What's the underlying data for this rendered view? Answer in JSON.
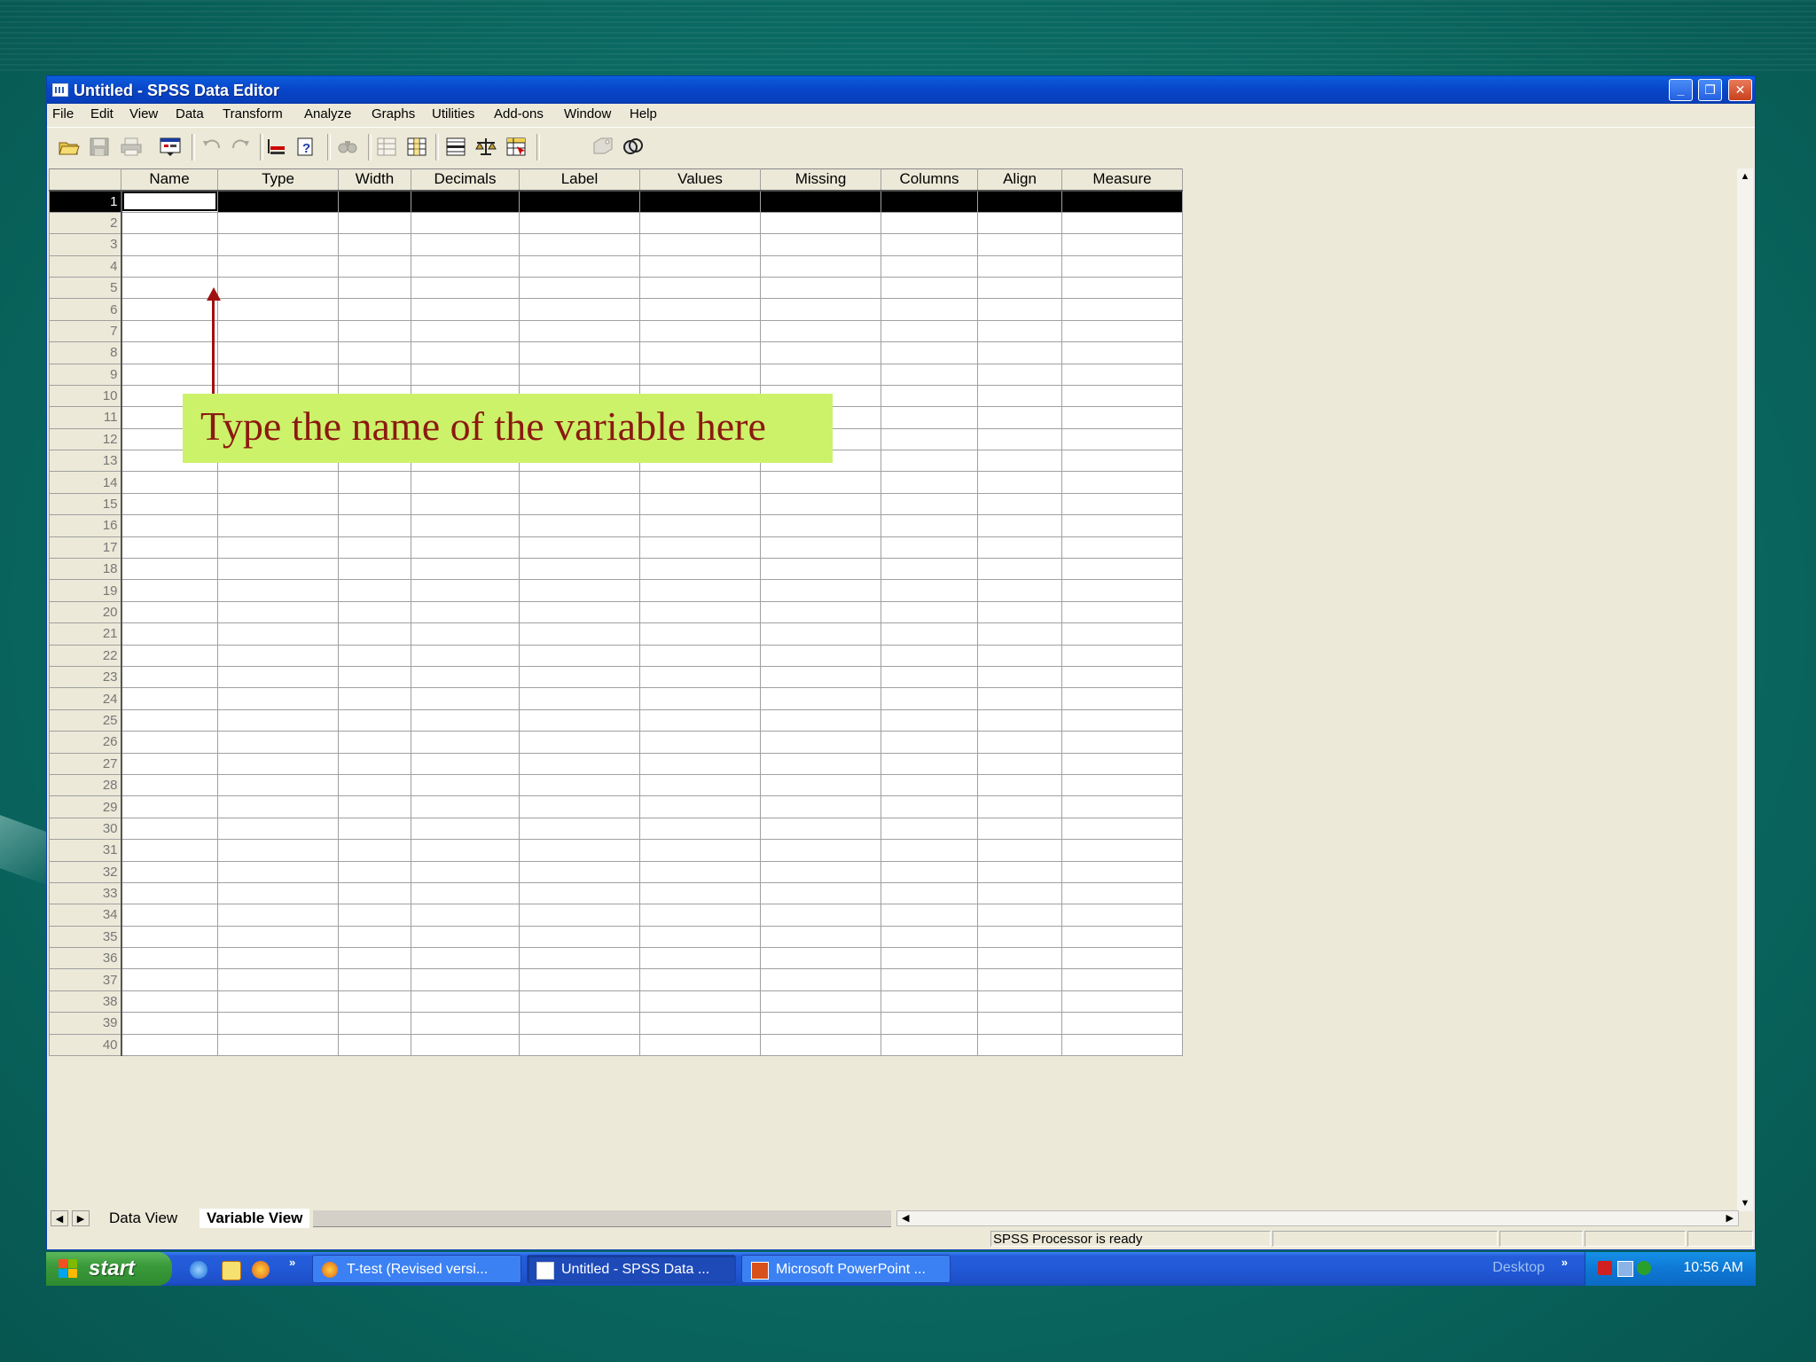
{
  "window": {
    "title": "Untitled - SPSS Data Editor"
  },
  "menu": [
    "File",
    "Edit",
    "View",
    "Data",
    "Transform",
    "Analyze",
    "Graphs",
    "Utilities",
    "Add-ons",
    "Window",
    "Help"
  ],
  "toolbar": {
    "buttons": [
      "open-icon",
      "save-icon",
      "print-icon",
      "dialog-recall-icon",
      "undo-icon",
      "redo-icon",
      "goto-case-icon",
      "variables-icon",
      "find-icon",
      "insert-cases-icon",
      "insert-variable-icon",
      "split-file-icon",
      "weight-cases-icon",
      "select-cases-icon",
      "value-labels-icon",
      "use-sets-icon"
    ]
  },
  "grid": {
    "columns": [
      "Name",
      "Type",
      "Width",
      "Decimals",
      "Label",
      "Values",
      "Missing",
      "Columns",
      "Align",
      "Measure"
    ],
    "row_numbers": [
      "1",
      "2",
      "3",
      "4",
      "5",
      "6",
      "7",
      "8",
      "9",
      "10",
      "11",
      "12",
      "13",
      "14",
      "15",
      "16",
      "17",
      "18",
      "19",
      "20",
      "21",
      "22",
      "23",
      "24",
      "25",
      "26",
      "27",
      "28",
      "29",
      "30",
      "31",
      "32",
      "33",
      "34",
      "35",
      "36",
      "37",
      "38",
      "39",
      "40"
    ],
    "selected_row": "1"
  },
  "annotation": {
    "text": "Type the name of the variable here"
  },
  "tabs": {
    "data_view": "Data View",
    "variable_view": "Variable View"
  },
  "status": {
    "message": "SPSS Processor  is ready"
  },
  "taskbar": {
    "start_label": "start",
    "tasks": [
      "T-test (Revised versi...",
      "Untitled - SPSS Data ...",
      "Microsoft PowerPoint ..."
    ],
    "desktop_label": "Desktop",
    "clock": "10:56 AM"
  },
  "colors": {
    "titlebar": "#0845c8",
    "callout_bg": "#ccf26a",
    "callout_text": "#8b1a10",
    "arrow": "#a01010"
  }
}
